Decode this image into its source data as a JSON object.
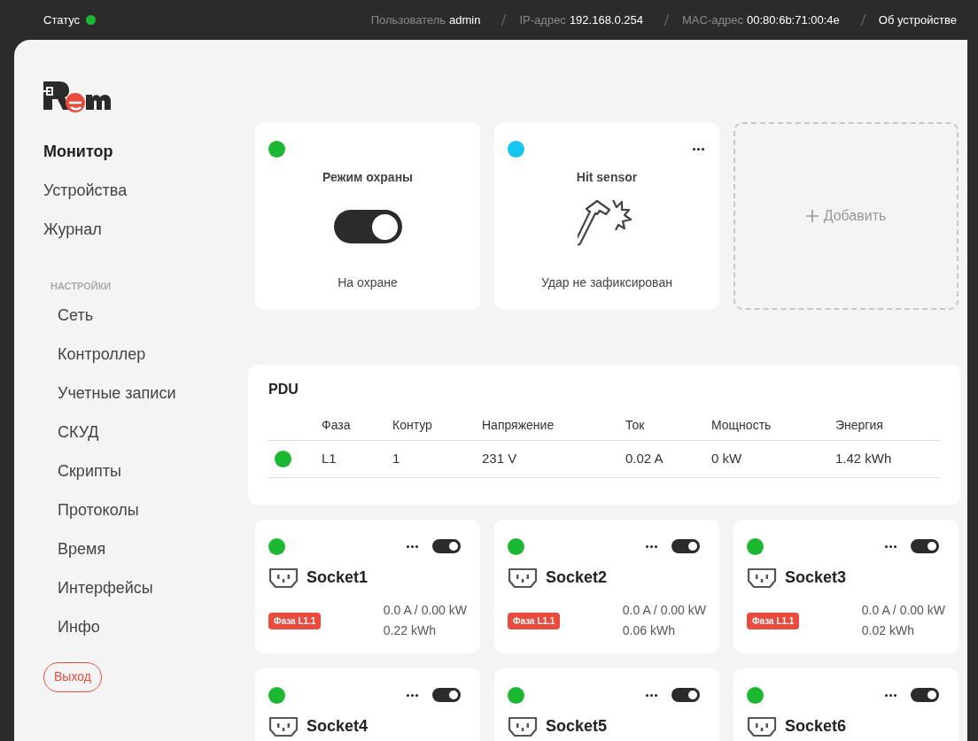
{
  "top_bar": {
    "status_label": "Статус",
    "online": true,
    "user_label": "Пользователь",
    "user": "admin",
    "ip_label": "IP-адрес",
    "ip": "192.168.0.254",
    "mac_label": "MAC-адрес",
    "mac": "00:80:6b:71:00:4e",
    "about": "Об устройстве"
  },
  "sidebar": {
    "nav": [
      {
        "label": "Монитор",
        "selected": true
      },
      {
        "label": "Устройства",
        "selected": false
      },
      {
        "label": "Журнал",
        "selected": false
      }
    ],
    "settings_heading": "НАСТРОЙКИ",
    "settings": [
      {
        "label": "Сеть"
      },
      {
        "label": "Контроллер"
      },
      {
        "label": "Учетные записи"
      },
      {
        "label": "СКУД"
      },
      {
        "label": "Скрипты"
      },
      {
        "label": "Протоколы"
      },
      {
        "label": "Время"
      },
      {
        "label": "Интерфейсы"
      },
      {
        "label": "Инфо"
      }
    ],
    "logout": "Выход"
  },
  "widgets": [
    {
      "kind": "switch",
      "color": "#1db832",
      "title": "Режим охраны",
      "on": true,
      "status": "На охране",
      "menu": false
    },
    {
      "kind": "sensor",
      "color": "#16c6f0",
      "title": "Hit sensor",
      "status": "Удар не зафиксирован",
      "menu": true
    },
    {
      "kind": "add",
      "label": "Добавить"
    }
  ],
  "pdu": {
    "title": "PDU",
    "columns": [
      "Фаза",
      "Контур",
      "Напряжение",
      "Ток",
      "Мощность",
      "Энергия"
    ],
    "rows": [
      {
        "color": "#1db832",
        "cells": [
          "L1",
          "1",
          "231 V",
          "0.02 A",
          "0 kW",
          "1.42 kWh"
        ]
      }
    ]
  },
  "sockets": [
    {
      "color": "#1db832",
      "on": true,
      "name": "Socket1",
      "phase": "Фаза L1.1",
      "reading": "0.0 A / 0.00 kW",
      "energy": "0.22 kWh"
    },
    {
      "color": "#1db832",
      "on": true,
      "name": "Socket2",
      "phase": "Фаза L1.1",
      "reading": "0.0 A / 0.00 kW",
      "energy": "0.06 kWh"
    },
    {
      "color": "#1db832",
      "on": true,
      "name": "Socket3",
      "phase": "Фаза L1.1",
      "reading": "0.0 A / 0.00 kW",
      "energy": "0.02 kWh"
    },
    {
      "color": "#1db832",
      "on": true,
      "name": "Socket4"
    },
    {
      "color": "#1db832",
      "on": true,
      "name": "Socket5"
    },
    {
      "color": "#1db832",
      "on": true,
      "name": "Socket6"
    }
  ]
}
